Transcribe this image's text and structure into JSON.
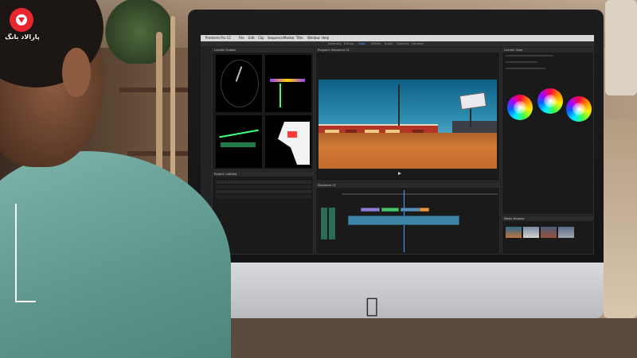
{
  "brand": {
    "logo_text": "پارالاد بانگ"
  },
  "screen": {
    "menu": [
      "Premiere Pro CC",
      "File",
      "Edit",
      "Clip",
      "Sequence",
      "Marker",
      "Title",
      "Window",
      "Help"
    ],
    "workspaces": [
      "Assembly",
      "Editing",
      "Color",
      "Effects",
      "Audio",
      "Graphics",
      "Libraries"
    ],
    "panels": {
      "scopes": "Lumetri Scopes",
      "program": "Program: Sequence 01",
      "lumetri": "Lumetri Color",
      "project": "Project: Untitled",
      "timeline": "Sequence 01",
      "media": "Media Browser"
    }
  },
  "colors": {
    "logo_red": "#e8262d",
    "shirt": "#6aa59c",
    "imac_chin": "#c9cace"
  },
  "icons": [
    "apple-logo-icon"
  ]
}
